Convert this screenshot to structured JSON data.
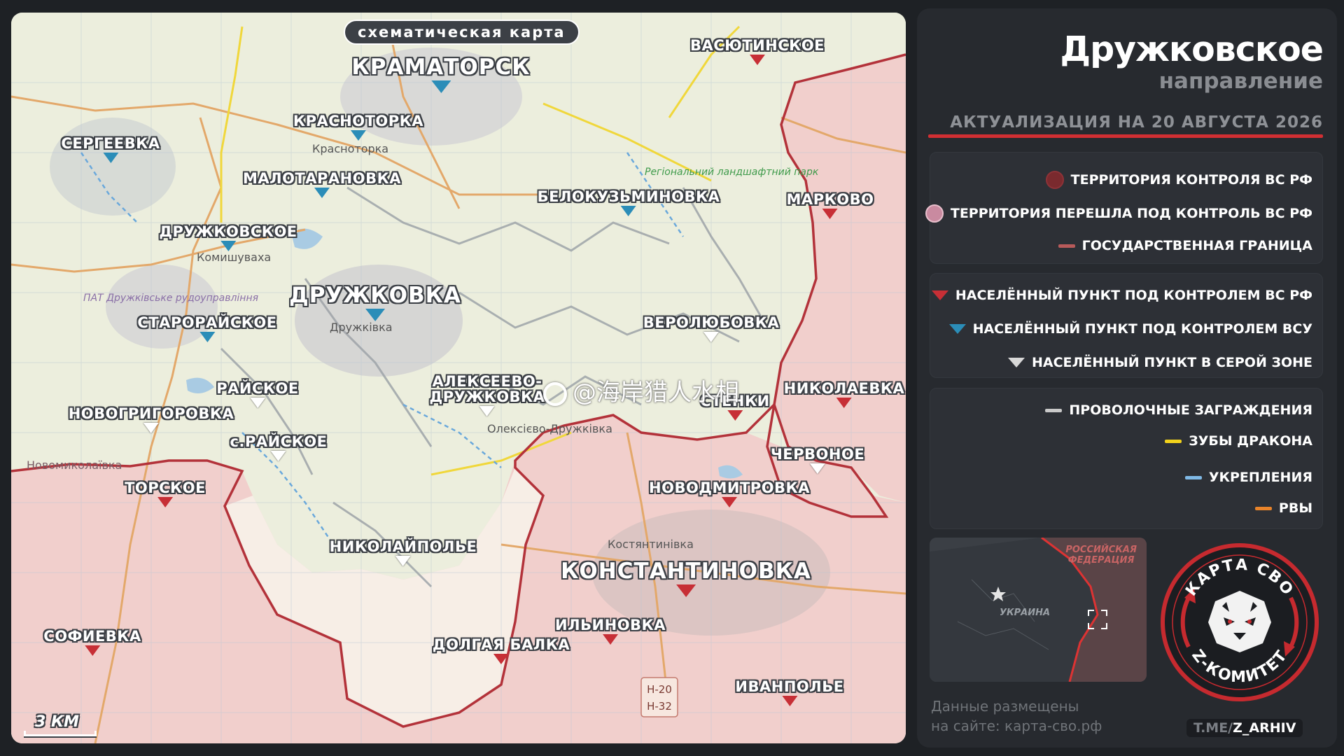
{
  "map": {
    "title": "схематическая карта",
    "scale_label": "3 КМ",
    "watermark": "@海岸猎人水相",
    "places": [
      {
        "id": "kramatorsk",
        "name": "КРАМАТОРСК",
        "status": "ua",
        "big": true
      },
      {
        "id": "vasyutinskoe",
        "name": "ВАСЮТИНСКОЕ",
        "status": "ru"
      },
      {
        "id": "krasnotorka",
        "name": "КРАСНОТОРКА",
        "status": "ua"
      },
      {
        "id": "sergeevka",
        "name": "СЕРГЕЕВКА",
        "status": "ua"
      },
      {
        "id": "malotaranovka",
        "name": "МАЛОТАРАНОВКА",
        "status": "ua"
      },
      {
        "id": "belokuzminovka",
        "name": "БЕЛОКУЗЬМИНОВКА",
        "status": "ua"
      },
      {
        "id": "markovo",
        "name": "МАРКОВО",
        "status": "ru"
      },
      {
        "id": "druzhkovskoe",
        "name": "ДРУЖКОВСКОЕ",
        "status": "ua"
      },
      {
        "id": "druzhkovka",
        "name": "ДРУЖКОВКА",
        "status": "ua",
        "big": true
      },
      {
        "id": "staroraiskoe",
        "name": "СТАРОРАЙСКОЕ",
        "status": "ua"
      },
      {
        "id": "verolyubovka",
        "name": "ВЕРОЛЮБОВКА",
        "status": "gray"
      },
      {
        "id": "raiskoe",
        "name": "РАЙСКОЕ",
        "status": "gray"
      },
      {
        "id": "alekseevo",
        "name": "АЛЕКСЕЕВО-\nДРУЖКОВКА",
        "status": "gray"
      },
      {
        "id": "stenki",
        "name": "СТЕНКИ",
        "status": "ru"
      },
      {
        "id": "nikolaevka",
        "name": "НИКОЛАЕВКА",
        "status": "ru"
      },
      {
        "id": "novogrigorovka",
        "name": "НОВОГРИГОРОВКА",
        "status": "gray"
      },
      {
        "id": "s_raiskoe",
        "name": "с.РАЙСКОЕ",
        "status": "gray"
      },
      {
        "id": "chervonoe",
        "name": "ЧЕРВОНОЕ",
        "status": "gray"
      },
      {
        "id": "torskoe",
        "name": "ТОРСКОЕ",
        "status": "ru"
      },
      {
        "id": "novodmitrovka",
        "name": "НОВОДМИТРОВКА",
        "status": "ru"
      },
      {
        "id": "nikolaipole",
        "name": "НИКОЛАЙПОЛЬЕ",
        "status": "gray"
      },
      {
        "id": "konstantinovka",
        "name": "КОНСТАНТИНОВКА",
        "status": "ru",
        "big": true
      },
      {
        "id": "sofievka",
        "name": "СОФИЕВКА",
        "status": "ru"
      },
      {
        "id": "ilinovka",
        "name": "ИЛЬИНОВКА",
        "status": "ru"
      },
      {
        "id": "dolgaya_balka",
        "name": "ДОЛГАЯ БАЛКА",
        "status": "ru"
      },
      {
        "id": "ivanpole",
        "name": "ИВАНПОЛЬЕ",
        "status": "ru"
      }
    ],
    "basemap_labels": [
      "Красноторка",
      "Комишуваха",
      "ПАТ Дружківське рудоуправління",
      "Дружківка",
      "Олексієво-Дружківка",
      "Новомиколаївка",
      "Костянтинівка",
      "Регіональний ландшафтний парк",
      "Н-20",
      "Н-32"
    ]
  },
  "panel": {
    "title": "Дружковское",
    "subtitle": "направление",
    "update": "АКТУАЛИЗАЦИЯ НА 20 АВГУСТА 2026",
    "legend_territory": [
      {
        "label": "ТЕРРИТОРИЯ КОНТРОЛЯ ВС РФ",
        "swatch": "circle",
        "color": "#7a2a2e"
      },
      {
        "label": "ТЕРРИТОРИЯ ПЕРЕШЛА ПОД КОНТРОЛЬ ВС РФ",
        "swatch": "circle",
        "color": "#c98aa0"
      },
      {
        "label": "ГОСУДАРСТВЕННАЯ ГРАНИЦА",
        "swatch": "line",
        "color": "#b85a5a"
      }
    ],
    "legend_places": [
      {
        "label": "НАСЕЛЁННЫЙ ПУНКТ ПОД КОНТРОЛЕМ ВС РФ",
        "color": "#c72f36"
      },
      {
        "label": "НАСЕЛЁННЫЙ ПУНКТ ПОД КОНТРОЛЕМ ВСУ",
        "color": "#2b8db8"
      },
      {
        "label": "НАСЕЛЁННЫЙ ПУНКТ В СЕРОЙ ЗОНЕ",
        "color": "#d8d8d8"
      }
    ],
    "legend_lines": [
      {
        "label": "ПРОВОЛОЧНЫЕ ЗАГРАЖДЕНИЯ",
        "color": "#c9c9c9"
      },
      {
        "label": "ЗУБЫ ДРАКОНА",
        "color": "#f2d21b"
      },
      {
        "label": "УКРЕПЛЕНИЯ",
        "color": "#7fb9e6"
      },
      {
        "label": "РВЫ",
        "color": "#e8832a"
      }
    ],
    "inset": {
      "russia": "РОССИЙСКАЯ\nФЕДЕРАЦИЯ",
      "ukraine": "УКРАИНА"
    },
    "emblem_top": "КАРТА СВО",
    "emblem_bottom": "Z-КОМИТЕТ",
    "data_note_1": "Данные размещены",
    "data_note_2": "на сайте: карта-сво.рф",
    "tg_prefix": "T.ME/",
    "tg_handle": "Z_ARHIV"
  },
  "colors": {
    "accent_red": "#d12f33",
    "ru_zone": "#f0c9c6",
    "ua_zone": "#eef0dc",
    "front": "#b3323a"
  }
}
